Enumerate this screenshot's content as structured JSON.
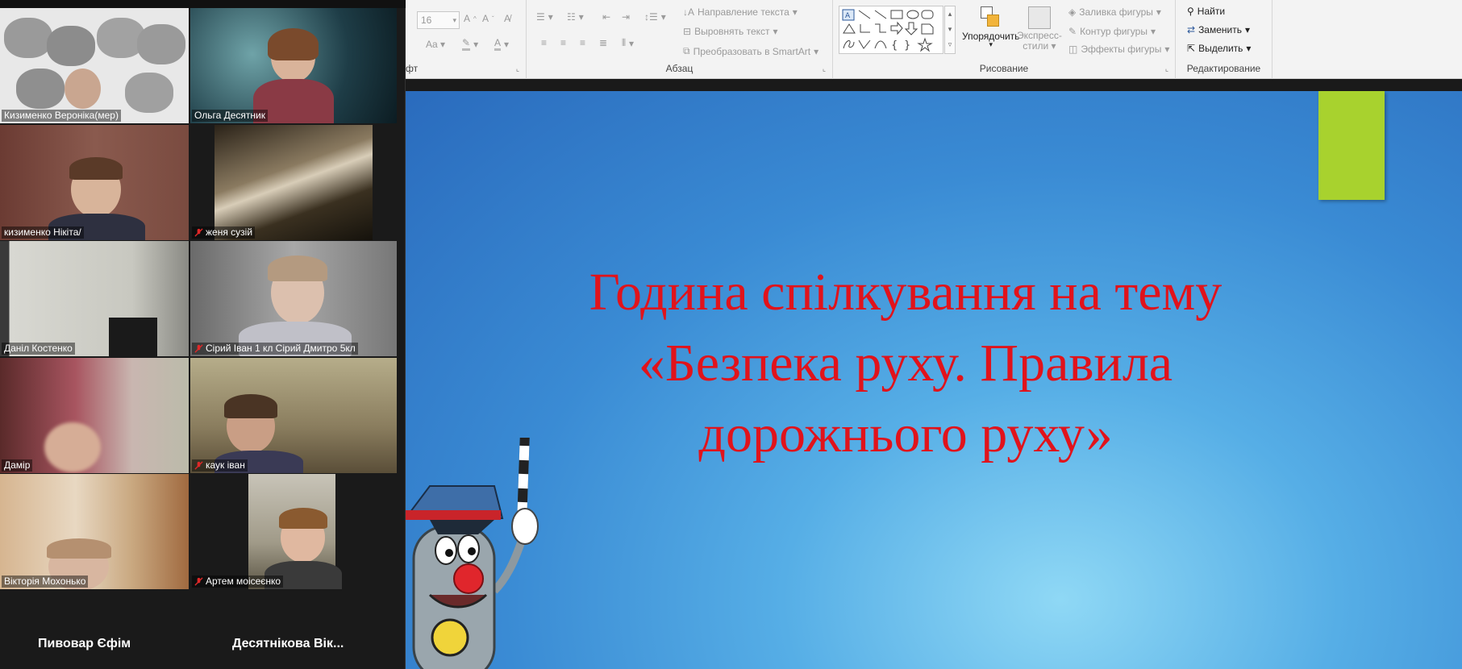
{
  "gallery": {
    "participants": [
      {
        "name": "Кизименко Вероніка(мер)",
        "muted": false
      },
      {
        "name": "Ольга Десятник",
        "muted": false
      },
      {
        "name": "кизименко Нікіта/",
        "muted": false
      },
      {
        "name": "женя сузій",
        "muted": true
      },
      {
        "name": "Даніл Костенко",
        "muted": false
      },
      {
        "name": "Сірий Іван 1 кл Сірий Дмитро 5кл",
        "muted": true
      },
      {
        "name": "Дамір",
        "muted": false
      },
      {
        "name": "каук іван",
        "muted": true
      },
      {
        "name": "Вікторія Мохонько",
        "muted": false
      },
      {
        "name": "Артем моісеєнко",
        "muted": true
      }
    ],
    "bottom_names": [
      "Пивовар Єфім",
      "Десятнікова Вік..."
    ]
  },
  "ribbon": {
    "font_group": {
      "label": "фт",
      "size_value": "16"
    },
    "paragraph_group": {
      "label": "Абзац",
      "text_direction": "Направление текста",
      "align_text": "Выровнять текст",
      "convert_smartart": "Преобразовать в SmartArt"
    },
    "drawing_group": {
      "label": "Рисование",
      "arrange": "Упорядочить",
      "quick_styles_1": "Экспресс-",
      "quick_styles_2": "стили",
      "shape_fill": "Заливка фигуры",
      "shape_outline": "Контур фигуры",
      "shape_effects": "Эффекты фигуры"
    },
    "editing_group": {
      "label": "Редактирование",
      "find": "Найти",
      "replace": "Заменить",
      "select": "Выделить"
    }
  },
  "slide": {
    "title_line1": "Година спілкування на тему",
    "title_line2": "«Безпека руху. Правила",
    "title_line3": "дорожнього руху»",
    "title_color": "#e1131b",
    "accent_color": "#a8d22e"
  }
}
